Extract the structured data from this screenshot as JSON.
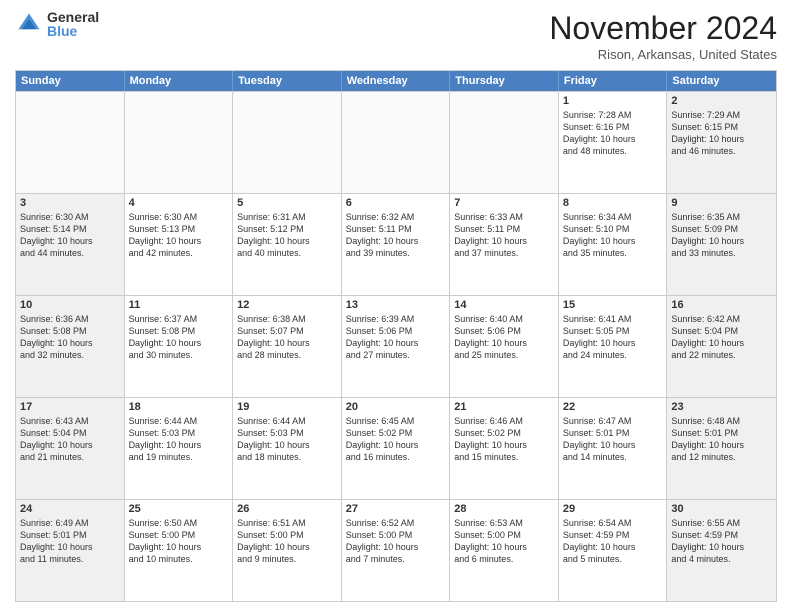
{
  "logo": {
    "general": "General",
    "blue": "Blue"
  },
  "header": {
    "month": "November 2024",
    "location": "Rison, Arkansas, United States"
  },
  "days": [
    "Sunday",
    "Monday",
    "Tuesday",
    "Wednesday",
    "Thursday",
    "Friday",
    "Saturday"
  ],
  "weeks": [
    [
      {
        "day": "",
        "empty": true
      },
      {
        "day": "",
        "empty": true
      },
      {
        "day": "",
        "empty": true
      },
      {
        "day": "",
        "empty": true
      },
      {
        "day": "",
        "empty": true
      },
      {
        "day": "1",
        "line1": "Sunrise: 7:28 AM",
        "line2": "Sunset: 6:16 PM",
        "line3": "Daylight: 10 hours",
        "line4": "and 48 minutes."
      },
      {
        "day": "2",
        "line1": "Sunrise: 7:29 AM",
        "line2": "Sunset: 6:15 PM",
        "line3": "Daylight: 10 hours",
        "line4": "and 46 minutes."
      }
    ],
    [
      {
        "day": "3",
        "line1": "Sunrise: 6:30 AM",
        "line2": "Sunset: 5:14 PM",
        "line3": "Daylight: 10 hours",
        "line4": "and 44 minutes."
      },
      {
        "day": "4",
        "line1": "Sunrise: 6:30 AM",
        "line2": "Sunset: 5:13 PM",
        "line3": "Daylight: 10 hours",
        "line4": "and 42 minutes."
      },
      {
        "day": "5",
        "line1": "Sunrise: 6:31 AM",
        "line2": "Sunset: 5:12 PM",
        "line3": "Daylight: 10 hours",
        "line4": "and 40 minutes."
      },
      {
        "day": "6",
        "line1": "Sunrise: 6:32 AM",
        "line2": "Sunset: 5:11 PM",
        "line3": "Daylight: 10 hours",
        "line4": "and 39 minutes."
      },
      {
        "day": "7",
        "line1": "Sunrise: 6:33 AM",
        "line2": "Sunset: 5:11 PM",
        "line3": "Daylight: 10 hours",
        "line4": "and 37 minutes."
      },
      {
        "day": "8",
        "line1": "Sunrise: 6:34 AM",
        "line2": "Sunset: 5:10 PM",
        "line3": "Daylight: 10 hours",
        "line4": "and 35 minutes."
      },
      {
        "day": "9",
        "line1": "Sunrise: 6:35 AM",
        "line2": "Sunset: 5:09 PM",
        "line3": "Daylight: 10 hours",
        "line4": "and 33 minutes."
      }
    ],
    [
      {
        "day": "10",
        "line1": "Sunrise: 6:36 AM",
        "line2": "Sunset: 5:08 PM",
        "line3": "Daylight: 10 hours",
        "line4": "and 32 minutes."
      },
      {
        "day": "11",
        "line1": "Sunrise: 6:37 AM",
        "line2": "Sunset: 5:08 PM",
        "line3": "Daylight: 10 hours",
        "line4": "and 30 minutes."
      },
      {
        "day": "12",
        "line1": "Sunrise: 6:38 AM",
        "line2": "Sunset: 5:07 PM",
        "line3": "Daylight: 10 hours",
        "line4": "and 28 minutes."
      },
      {
        "day": "13",
        "line1": "Sunrise: 6:39 AM",
        "line2": "Sunset: 5:06 PM",
        "line3": "Daylight: 10 hours",
        "line4": "and 27 minutes."
      },
      {
        "day": "14",
        "line1": "Sunrise: 6:40 AM",
        "line2": "Sunset: 5:06 PM",
        "line3": "Daylight: 10 hours",
        "line4": "and 25 minutes."
      },
      {
        "day": "15",
        "line1": "Sunrise: 6:41 AM",
        "line2": "Sunset: 5:05 PM",
        "line3": "Daylight: 10 hours",
        "line4": "and 24 minutes."
      },
      {
        "day": "16",
        "line1": "Sunrise: 6:42 AM",
        "line2": "Sunset: 5:04 PM",
        "line3": "Daylight: 10 hours",
        "line4": "and 22 minutes."
      }
    ],
    [
      {
        "day": "17",
        "line1": "Sunrise: 6:43 AM",
        "line2": "Sunset: 5:04 PM",
        "line3": "Daylight: 10 hours",
        "line4": "and 21 minutes."
      },
      {
        "day": "18",
        "line1": "Sunrise: 6:44 AM",
        "line2": "Sunset: 5:03 PM",
        "line3": "Daylight: 10 hours",
        "line4": "and 19 minutes."
      },
      {
        "day": "19",
        "line1": "Sunrise: 6:44 AM",
        "line2": "Sunset: 5:03 PM",
        "line3": "Daylight: 10 hours",
        "line4": "and 18 minutes."
      },
      {
        "day": "20",
        "line1": "Sunrise: 6:45 AM",
        "line2": "Sunset: 5:02 PM",
        "line3": "Daylight: 10 hours",
        "line4": "and 16 minutes."
      },
      {
        "day": "21",
        "line1": "Sunrise: 6:46 AM",
        "line2": "Sunset: 5:02 PM",
        "line3": "Daylight: 10 hours",
        "line4": "and 15 minutes."
      },
      {
        "day": "22",
        "line1": "Sunrise: 6:47 AM",
        "line2": "Sunset: 5:01 PM",
        "line3": "Daylight: 10 hours",
        "line4": "and 14 minutes."
      },
      {
        "day": "23",
        "line1": "Sunrise: 6:48 AM",
        "line2": "Sunset: 5:01 PM",
        "line3": "Daylight: 10 hours",
        "line4": "and 12 minutes."
      }
    ],
    [
      {
        "day": "24",
        "line1": "Sunrise: 6:49 AM",
        "line2": "Sunset: 5:01 PM",
        "line3": "Daylight: 10 hours",
        "line4": "and 11 minutes."
      },
      {
        "day": "25",
        "line1": "Sunrise: 6:50 AM",
        "line2": "Sunset: 5:00 PM",
        "line3": "Daylight: 10 hours",
        "line4": "and 10 minutes."
      },
      {
        "day": "26",
        "line1": "Sunrise: 6:51 AM",
        "line2": "Sunset: 5:00 PM",
        "line3": "Daylight: 10 hours",
        "line4": "and 9 minutes."
      },
      {
        "day": "27",
        "line1": "Sunrise: 6:52 AM",
        "line2": "Sunset: 5:00 PM",
        "line3": "Daylight: 10 hours",
        "line4": "and 7 minutes."
      },
      {
        "day": "28",
        "line1": "Sunrise: 6:53 AM",
        "line2": "Sunset: 5:00 PM",
        "line3": "Daylight: 10 hours",
        "line4": "and 6 minutes."
      },
      {
        "day": "29",
        "line1": "Sunrise: 6:54 AM",
        "line2": "Sunset: 4:59 PM",
        "line3": "Daylight: 10 hours",
        "line4": "and 5 minutes."
      },
      {
        "day": "30",
        "line1": "Sunrise: 6:55 AM",
        "line2": "Sunset: 4:59 PM",
        "line3": "Daylight: 10 hours",
        "line4": "and 4 minutes."
      }
    ]
  ]
}
